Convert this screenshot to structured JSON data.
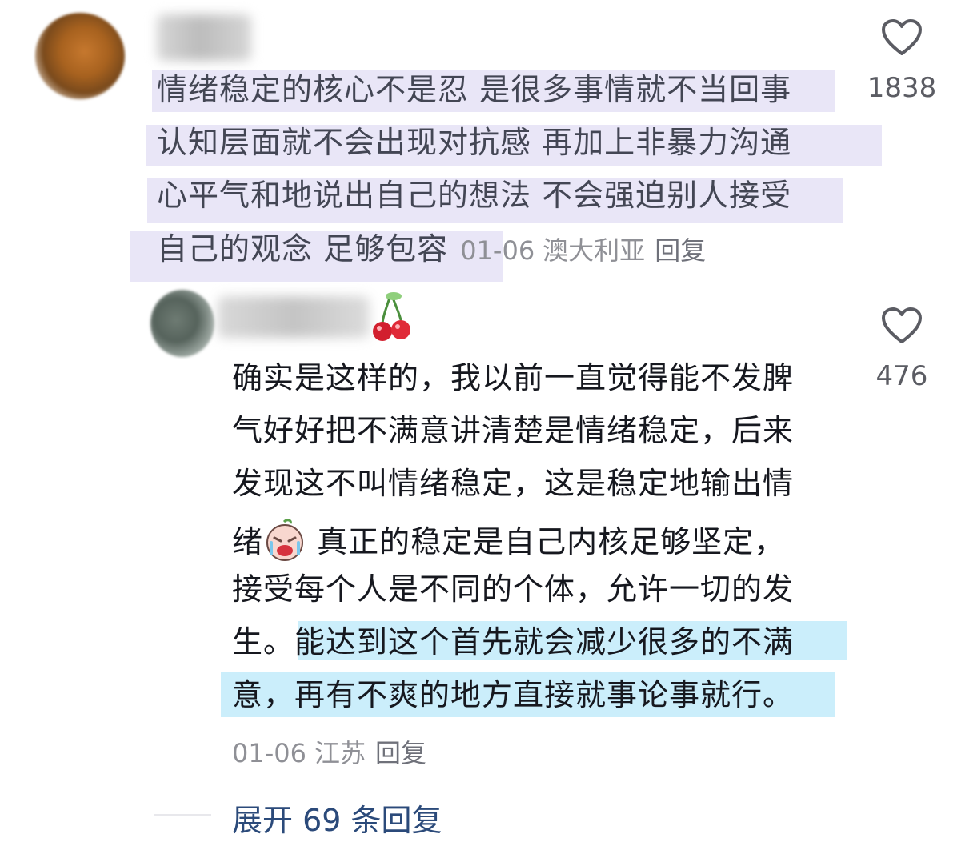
{
  "comment1": {
    "lines": [
      "情绪稳定的核心不是忍 是很多事情就不当回事",
      "认知层面就不会出现对抗感 再加上非暴力沟通",
      "心平气和地说出自己的想法 不会强迫别人接受",
      "自己的观念 足够包容"
    ],
    "date": "01-06",
    "location": "澳大利亚",
    "reply_label": "回复",
    "like_count": "1838"
  },
  "comment2": {
    "lines": [
      "确实是这样的，我以前一直觉得能不发脾",
      "气好好把不满意讲清楚是情绪稳定，后来",
      "发现这不叫情绪稳定，这是稳定地输出情",
      "绪",
      " 真正的稳定是自己内核足够坚定，",
      "接受每个人是不同的个体，允许一切的发",
      "生。能达到这个首先就会减少很多的不满",
      "意，再有不爽的地方直接就事论事就行。"
    ],
    "date": "01-06",
    "location": "江苏",
    "reply_label": "回复",
    "like_count": "476"
  },
  "expand_replies": "展开 69 条回复",
  "icons": {
    "like": "heart-outline-icon",
    "emoji": "crying-face-emoji-icon",
    "badge": "cherry-icon"
  },
  "colors": {
    "purple_highlight": "#e9e6f7",
    "blue_highlight": "#cbeefb",
    "link": "#2b4a7a"
  }
}
